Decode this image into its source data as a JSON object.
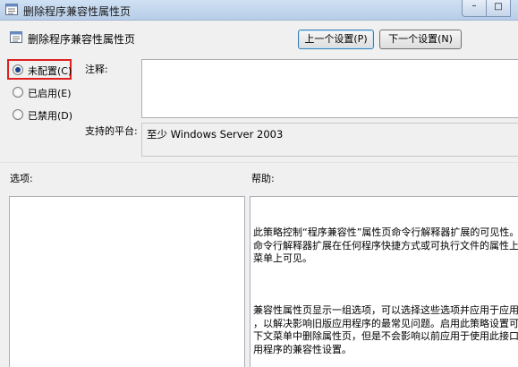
{
  "window": {
    "title": "删除程序兼容性属性页",
    "min_label": "–",
    "max_label": "□"
  },
  "header": {
    "policy_name": "删除程序兼容性属性页"
  },
  "nav": {
    "prev_label": "上一个设置(P)",
    "next_label": "下一个设置(N)"
  },
  "state": {
    "selected": "not_configured",
    "options": [
      {
        "id": "not_configured",
        "label": "未配置(C)"
      },
      {
        "id": "enabled",
        "label": "已启用(E)"
      },
      {
        "id": "disabled",
        "label": "已禁用(D)"
      }
    ]
  },
  "comment": {
    "label": "注释:",
    "value": ""
  },
  "platform": {
    "label": "支持的平台:",
    "value": "至少 Windows Server 2003"
  },
  "options_pane": {
    "label": "选项:"
  },
  "help_pane": {
    "label": "帮助:",
    "lines_p1": [
      "此策略控制“程序兼容性”属性页命令行解释器扩展的可见性。此",
      "命令行解释器扩展在任何程序快捷方式或可执行文件的属性上下文",
      "菜单上可见。"
    ],
    "lines_p2": [
      "兼容性属性页显示一组选项，可以选择这些选项并应用于应用程序",
      "，以解决影响旧版应用程序的最常见问题。启用此策略设置可从上",
      "下文菜单中删除属性页，但是不会影响以前应用于使用此接口的应",
      "用程序的兼容性设置。"
    ]
  },
  "icons": {
    "policy": "policy-sheet-icon"
  }
}
